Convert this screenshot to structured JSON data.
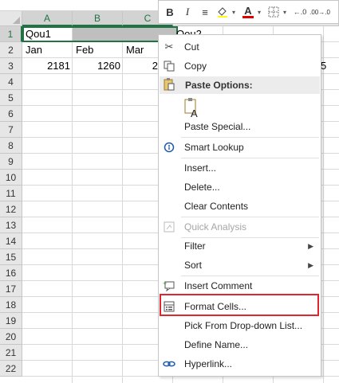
{
  "columns": [
    "A",
    "B",
    "C"
  ],
  "rows": [
    "1",
    "2",
    "3",
    "4",
    "5",
    "6",
    "7",
    "8",
    "9",
    "10",
    "11",
    "12",
    "13",
    "14",
    "15",
    "16",
    "17",
    "18",
    "19",
    "20",
    "21",
    "22"
  ],
  "cells": {
    "a1": "Qou1",
    "d1": "Qou2",
    "a2": "Jan",
    "b2": "Feb",
    "c2": "Mar",
    "a3": "2181",
    "b3": "1260",
    "c3": "2",
    "e3": "5"
  },
  "mini_toolbar": {
    "bold": "B",
    "italic": "I",
    "align": "≡",
    "fill": "fill-color-icon",
    "font_color": "A",
    "borders": "borders-icon",
    "dec_decimal": "←.0",
    "inc_decimal": ".00→.0"
  },
  "context_menu": {
    "cut": "Cut",
    "copy": "Copy",
    "paste_options": "Paste Options:",
    "paste_special": "Paste Special...",
    "smart_lookup": "Smart Lookup",
    "insert": "Insert...",
    "delete": "Delete...",
    "clear_contents": "Clear Contents",
    "quick_analysis": "Quick Analysis",
    "filter": "Filter",
    "sort": "Sort",
    "insert_comment": "Insert Comment",
    "format_cells": "Format Cells...",
    "pick_from_list": "Pick From Drop-down List...",
    "define_name": "Define Name...",
    "hyperlink": "Hyperlink..."
  },
  "colors": {
    "selection": "#217346",
    "highlight": "#e0262c",
    "font_color_bar": "#e00000"
  }
}
